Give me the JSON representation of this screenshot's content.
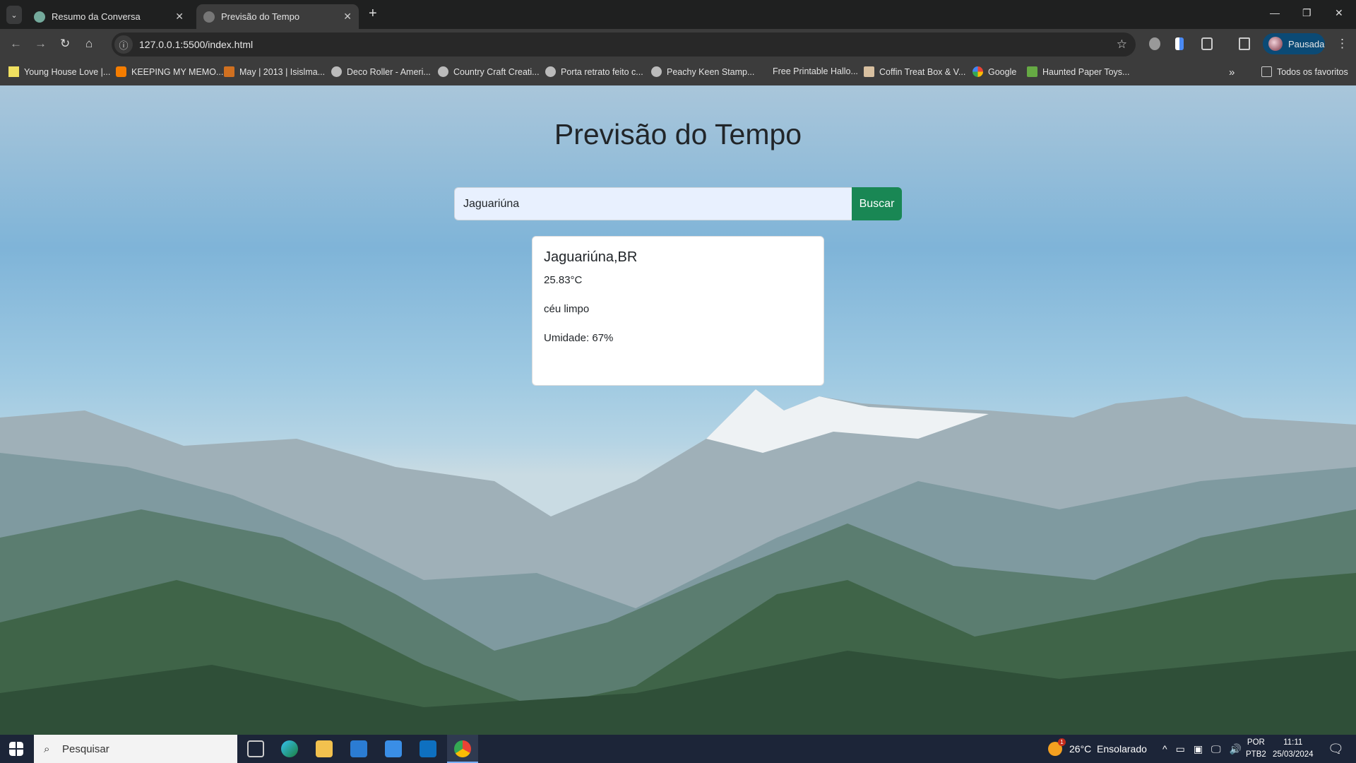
{
  "browser": {
    "tabs": [
      {
        "title": "Resumo da Conversa",
        "active": false
      },
      {
        "title": "Previsão do Tempo",
        "active": true
      }
    ],
    "url": "127.0.0.1:5500/index.html",
    "profile_label": "Pausada",
    "bookmarks": [
      "Young House Love |...",
      "KEEPING MY MEMO...",
      "May | 2013 | Isislma...",
      "Deco Roller - Ameri...",
      "Country Craft Creati...",
      "Porta retrato feito c...",
      "Peachy Keen Stamp...",
      "Free Printable Hallo...",
      "Coffin Treat Box & V...",
      "Google",
      "Haunted Paper Toys..."
    ],
    "all_bookmarks": "Todos os favoritos"
  },
  "app": {
    "title": "Previsão do Tempo",
    "search_value": "Jaguariúna",
    "search_button": "Buscar",
    "result": {
      "city": "Jaguariúna,BR",
      "temperature": "25.83°C",
      "description": "céu limpo",
      "humidity": "Umidade: 67%"
    }
  },
  "taskbar": {
    "search_placeholder": "Pesquisar",
    "weather": "26°C  Ensolarado",
    "weather_badge": "1",
    "lang1": "POR",
    "lang2": "PTB2",
    "time": "11:11",
    "date": "25/03/2024"
  },
  "colors": {
    "accent": "#198754",
    "input_bg": "#e8f0fe"
  }
}
